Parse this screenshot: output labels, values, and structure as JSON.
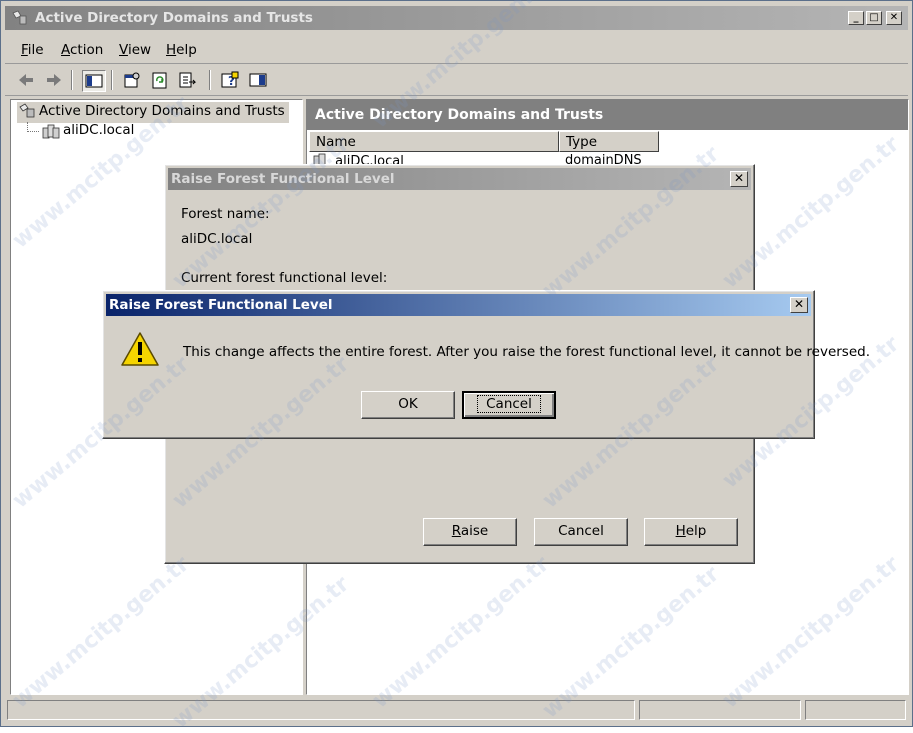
{
  "window": {
    "title": "Active Directory Domains and Trusts",
    "controls": {
      "minimize": "_",
      "maximize": "□",
      "close": "✕"
    }
  },
  "menubar": {
    "items": [
      {
        "label": "File",
        "accel": "F",
        "rest": "ile"
      },
      {
        "label": "Action",
        "accel": "A",
        "rest": "ction"
      },
      {
        "label": "View",
        "accel": "V",
        "rest": "iew"
      },
      {
        "label": "Help",
        "accel": "H",
        "rest": "elp"
      }
    ]
  },
  "toolbar": {
    "icons": [
      "back-arrow-icon",
      "forward-arrow-icon",
      "show-hide-console-tree-icon",
      "properties-icon",
      "refresh-icon",
      "export-list-icon",
      "help-icon",
      "action-pane-icon"
    ]
  },
  "tree": {
    "root_label": "Active Directory Domains and Trusts",
    "child_label": "aliDC.local"
  },
  "details": {
    "header": "Active Directory Domains and Trusts",
    "columns": [
      "Name",
      "Type"
    ],
    "rows": [
      {
        "name": "aliDC.local",
        "type": "domainDNS"
      }
    ]
  },
  "dialog_back": {
    "title": "Raise Forest Functional Level",
    "forest_name_label": "Forest name:",
    "forest_name_value": "aliDC.local",
    "current_level_label": "Current forest functional level:",
    "buttons": {
      "raise": {
        "accel": "R",
        "rest": "aise"
      },
      "cancel": "Cancel",
      "help": {
        "accel": "H",
        "rest": "elp"
      }
    }
  },
  "dialog_front": {
    "title": "Raise Forest Functional Level",
    "message": "This change affects the entire forest. After you raise the forest functional level, it cannot be reversed.",
    "ok_label": "OK",
    "cancel_label": "Cancel",
    "icon": "warning-icon"
  },
  "watermark_text": "www.mcitp.gen.tr",
  "colors": {
    "active_title_start": "#0a246a",
    "active_title_end": "#a6caf0",
    "inactive_title_start": "#828282",
    "inactive_title_end": "#b5b5b5",
    "face": "#d4d0c8",
    "warning": "#f5d400"
  }
}
